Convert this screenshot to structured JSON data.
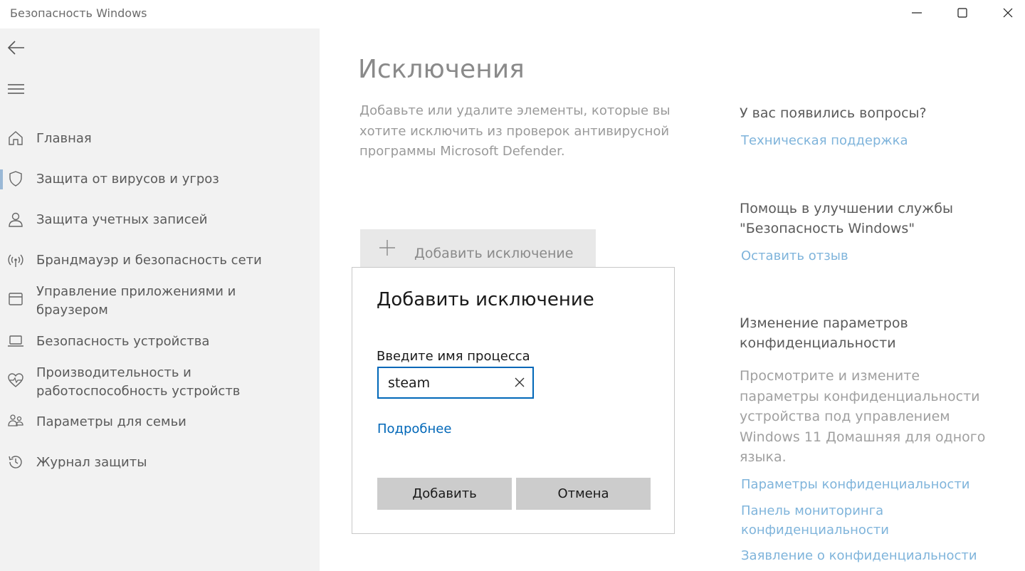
{
  "window": {
    "title": "Безопасность Windows"
  },
  "sidebar": {
    "items": [
      {
        "label": "Главная",
        "icon": "home-icon"
      },
      {
        "label": "Защита от вирусов и угроз",
        "icon": "shield-icon",
        "active": true
      },
      {
        "label": "Защита учетных записей",
        "icon": "person-icon"
      },
      {
        "label": "Брандмауэр и безопасность сети",
        "icon": "wireless-icon"
      },
      {
        "label": "Управление приложениями и браузером",
        "icon": "app-browser-icon"
      },
      {
        "label": "Безопасность устройства",
        "icon": "laptop-icon"
      },
      {
        "label": "Производительность и работоспособность устройств",
        "icon": "heart-pulse-icon"
      },
      {
        "label": "Параметры для семьи",
        "icon": "family-icon"
      },
      {
        "label": "Журнал защиты",
        "icon": "history-icon"
      }
    ]
  },
  "main": {
    "title": "Исключения",
    "description": "Добавьте или удалите элементы, которые вы хотите исключить из проверок антивирусной программы Microsoft Defender.",
    "add_exclusion_label": "Добавить исключение"
  },
  "dialog": {
    "title": "Добавить исключение",
    "input_label": "Введите имя процесса",
    "input_value": "steam",
    "more_link": "Подробнее",
    "add_button": "Добавить",
    "cancel_button": "Отмена"
  },
  "right_panel": {
    "questions_heading": "У вас появились вопросы?",
    "support_link": "Техническая поддержка",
    "improve_heading": "Помощь в улучшении службы \"Безопасность Windows\"",
    "feedback_link": "Оставить отзыв",
    "privacy_heading": "Изменение параметров конфиденциальности",
    "privacy_text": "Просмотрите и измените параметры конфиденциальности устройства под управлением Windows 11 Домашняя для одного языка.",
    "privacy_settings_link": "Параметры конфиденциальности",
    "privacy_dashboard_link": "Панель мониторинга конфиденциальности",
    "privacy_statement_link": "Заявление о конфиденциальности"
  },
  "colors": {
    "accent": "#0067b8",
    "link_muted": "#7fb4db",
    "sidebar_bg": "#f2f2f2"
  }
}
